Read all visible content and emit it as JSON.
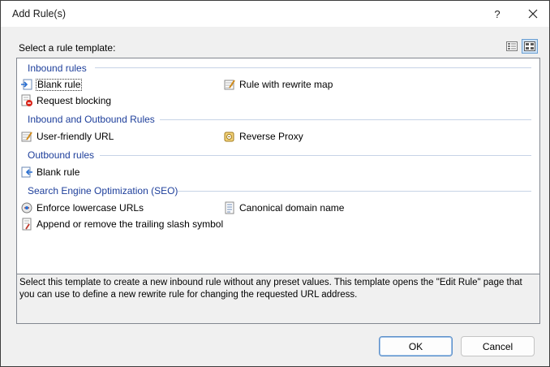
{
  "window": {
    "title": "Add Rule(s)",
    "help_glyph": "?",
    "close_glyph": "✕"
  },
  "prompt": "Select a rule template:",
  "groups": [
    {
      "header": "Inbound rules",
      "items": [
        {
          "label": "Blank rule",
          "icon": "blank-inbound-rule-icon",
          "selected": true
        },
        {
          "label": "Rule with rewrite map",
          "icon": "rewrite-map-icon"
        },
        {
          "label": "Request blocking",
          "icon": "request-blocking-icon"
        }
      ]
    },
    {
      "header": "Inbound and Outbound Rules",
      "items": [
        {
          "label": "User-friendly URL",
          "icon": "user-friendly-url-icon"
        },
        {
          "label": "Reverse Proxy",
          "icon": "reverse-proxy-icon"
        }
      ]
    },
    {
      "header": "Outbound rules",
      "items": [
        {
          "label": "Blank rule",
          "icon": "blank-outbound-rule-icon"
        }
      ]
    },
    {
      "header": "Search Engine Optimization (SEO)",
      "items": [
        {
          "label": "Enforce lowercase URLs",
          "icon": "lowercase-url-icon"
        },
        {
          "label": "Canonical domain name",
          "icon": "canonical-domain-icon"
        },
        {
          "label": "Append or remove the trailing slash symbol",
          "icon": "trailing-slash-icon"
        }
      ]
    }
  ],
  "description": "Select this template to create a new inbound rule without any preset values. This template opens the \"Edit Rule\" page that you can use to define a new rewrite rule for changing the requested URL address.",
  "buttons": {
    "ok": "OK",
    "cancel": "Cancel"
  },
  "view_modes": [
    "list-view-icon",
    "tile-view-icon"
  ],
  "colors": {
    "group_header": "#1e3f9b",
    "selection_border": "#6a9fd3",
    "dialog_bg": "#f0f0f0"
  }
}
